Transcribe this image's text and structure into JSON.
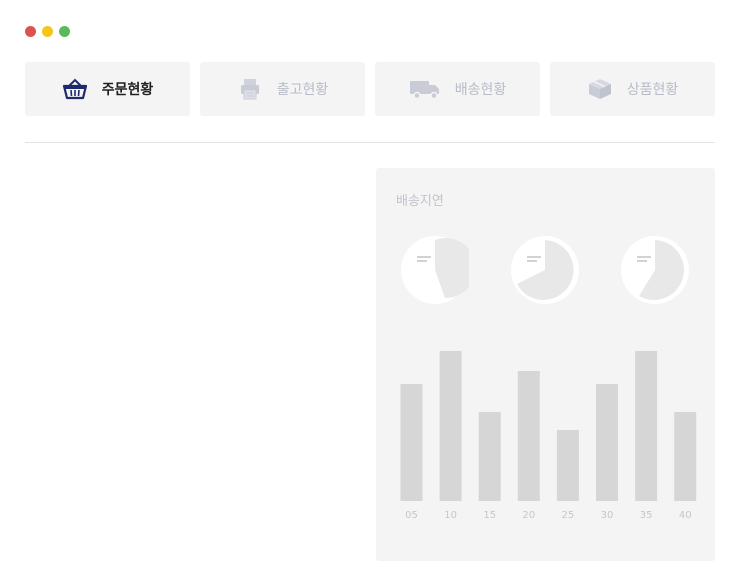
{
  "window": {
    "controls": [
      "close",
      "minimize",
      "maximize"
    ]
  },
  "tabs": [
    {
      "label": "주문현황",
      "icon": "basket-icon",
      "active": true
    },
    {
      "label": "출고현황",
      "icon": "printer-icon",
      "active": false
    },
    {
      "label": "배송현황",
      "icon": "truck-icon",
      "active": false
    },
    {
      "label": "상품현황",
      "icon": "box-icon",
      "active": false
    }
  ],
  "colors": {
    "active_icon": "#1f2a6e",
    "inactive": "#b8bcc8",
    "panel_bg": "#f4f4f4",
    "bar": "#d6d6d6",
    "pie": "#e8e8e8"
  },
  "panel": {
    "title": "배송지연"
  },
  "chart_data": {
    "type": "bar",
    "categories": [
      "05",
      "10",
      "15",
      "20",
      "25",
      "30",
      "35",
      "40"
    ],
    "values": [
      117,
      150,
      89,
      130,
      71,
      117,
      150,
      89
    ],
    "ylim": [
      0,
      150
    ],
    "grid": false,
    "title": "",
    "xlabel": "",
    "ylabel": ""
  },
  "mini_pies": [
    {
      "slice_fraction": 0.67,
      "icon": "document-icon"
    },
    {
      "slice_fraction": 0.6,
      "icon": "document-icon"
    },
    {
      "slice_fraction": 0.58,
      "icon": "document-icon"
    }
  ]
}
